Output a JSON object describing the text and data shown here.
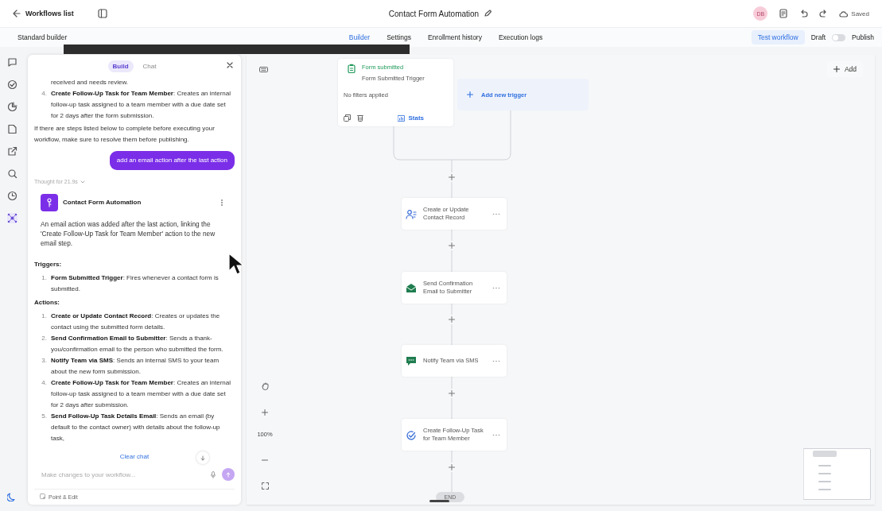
{
  "header": {
    "back_label": "Workflows list",
    "title": "Contact Form Automation",
    "avatar": "DB",
    "save_status": "Saved"
  },
  "subheader": {
    "builder_type": "Standard builder",
    "tabs": [
      {
        "label": "Builder",
        "selected": true
      },
      {
        "label": "Settings",
        "selected": false
      },
      {
        "label": "Enrollment history",
        "selected": false
      },
      {
        "label": "Execution logs",
        "selected": false
      }
    ],
    "test_button": "Test workflow",
    "draft_label": "Draft",
    "publish_toggle": {
      "on": false
    },
    "publish_label": "Publish"
  },
  "rail": {
    "items": [
      {
        "selected": false
      },
      {
        "selected": false
      },
      {
        "selected": false
      },
      {
        "selected": false
      },
      {
        "selected": false
      },
      {
        "selected": false
      },
      {
        "selected": false
      },
      {
        "selected": true
      }
    ]
  },
  "chat": {
    "modes": [
      {
        "label": "Build",
        "selected": true
      },
      {
        "label": "Chat",
        "selected": false
      }
    ],
    "messages": [
      {
        "kind": "list",
        "items": [
          {
            "text": "received and needs review."
          },
          {
            "number": "4.",
            "text": "**Create Follow-Up Task for Team Member**: Creates an internal follow-up task assigned to a team member with a due date set for 2 days after the form submission."
          }
        ]
      },
      {
        "kind": "paragraph",
        "text": "If there are steps listed below to complete before executing your workflow, make sure to resolve them before publishing."
      },
      {
        "kind": "user",
        "text": "add an email action after the last action"
      },
      {
        "kind": "thought",
        "text": "Thought for 21.9s"
      },
      {
        "kind": "card",
        "title": "Contact Form Automation",
        "text": "An email action was added after the last action, linking the 'Create Follow-Up Task for Team Member' action to the new email step."
      },
      {
        "kind": "heading",
        "text": "Triggers:"
      },
      {
        "kind": "list",
        "items": [
          {
            "number": "1.",
            "text": "**Form Submitted Trigger**: Fires whenever a contact form is submitted."
          }
        ]
      },
      {
        "kind": "heading",
        "text": "Actions:"
      },
      {
        "kind": "list",
        "items": [
          {
            "number": "1.",
            "text": "**Create or Update Contact Record**: Creates or updates the contact using the submitted form details."
          },
          {
            "number": "2.",
            "text": "**Send Confirmation Email to Submitter**: Sends a thank-you/confirmation email to the person who submitted the form."
          },
          {
            "number": "3.",
            "text": "**Notify Team via SMS**: Sends an internal SMS to your team about the new form submission."
          },
          {
            "number": "4.",
            "text": "**Create Follow-Up Task for Team Member**: Creates an internal follow-up task assigned to a team member with a due date set for 2 days after submission."
          },
          {
            "number": "5.",
            "text": "**Send Follow-Up Task Details Email**: Sends an email (by default to the contact owner) with details about the follow-up task,"
          }
        ]
      }
    ],
    "clear_label": "Clear chat",
    "input": {
      "placeholder": "Make changes to your workflow..."
    },
    "point_edit_label": "Point & Edit"
  },
  "canvas": {
    "trigger": {
      "title": "Form submitted",
      "subtitle": "Form Submitted Trigger",
      "filters": "No filters applied",
      "stats_label": "Stats"
    },
    "add_trigger_label": "Add new trigger",
    "actions": [
      {
        "kind": "contact",
        "label": "Create or Update Contact Record"
      },
      {
        "kind": "email",
        "label": "Send Confirmation Email to Submitter"
      },
      {
        "kind": "sms",
        "label": "Notify Team via SMS"
      },
      {
        "kind": "task",
        "label": "Create Follow-Up Task for Team Member"
      }
    ],
    "end_label": "END",
    "zoom_label": "100%",
    "add_label": "Add"
  }
}
